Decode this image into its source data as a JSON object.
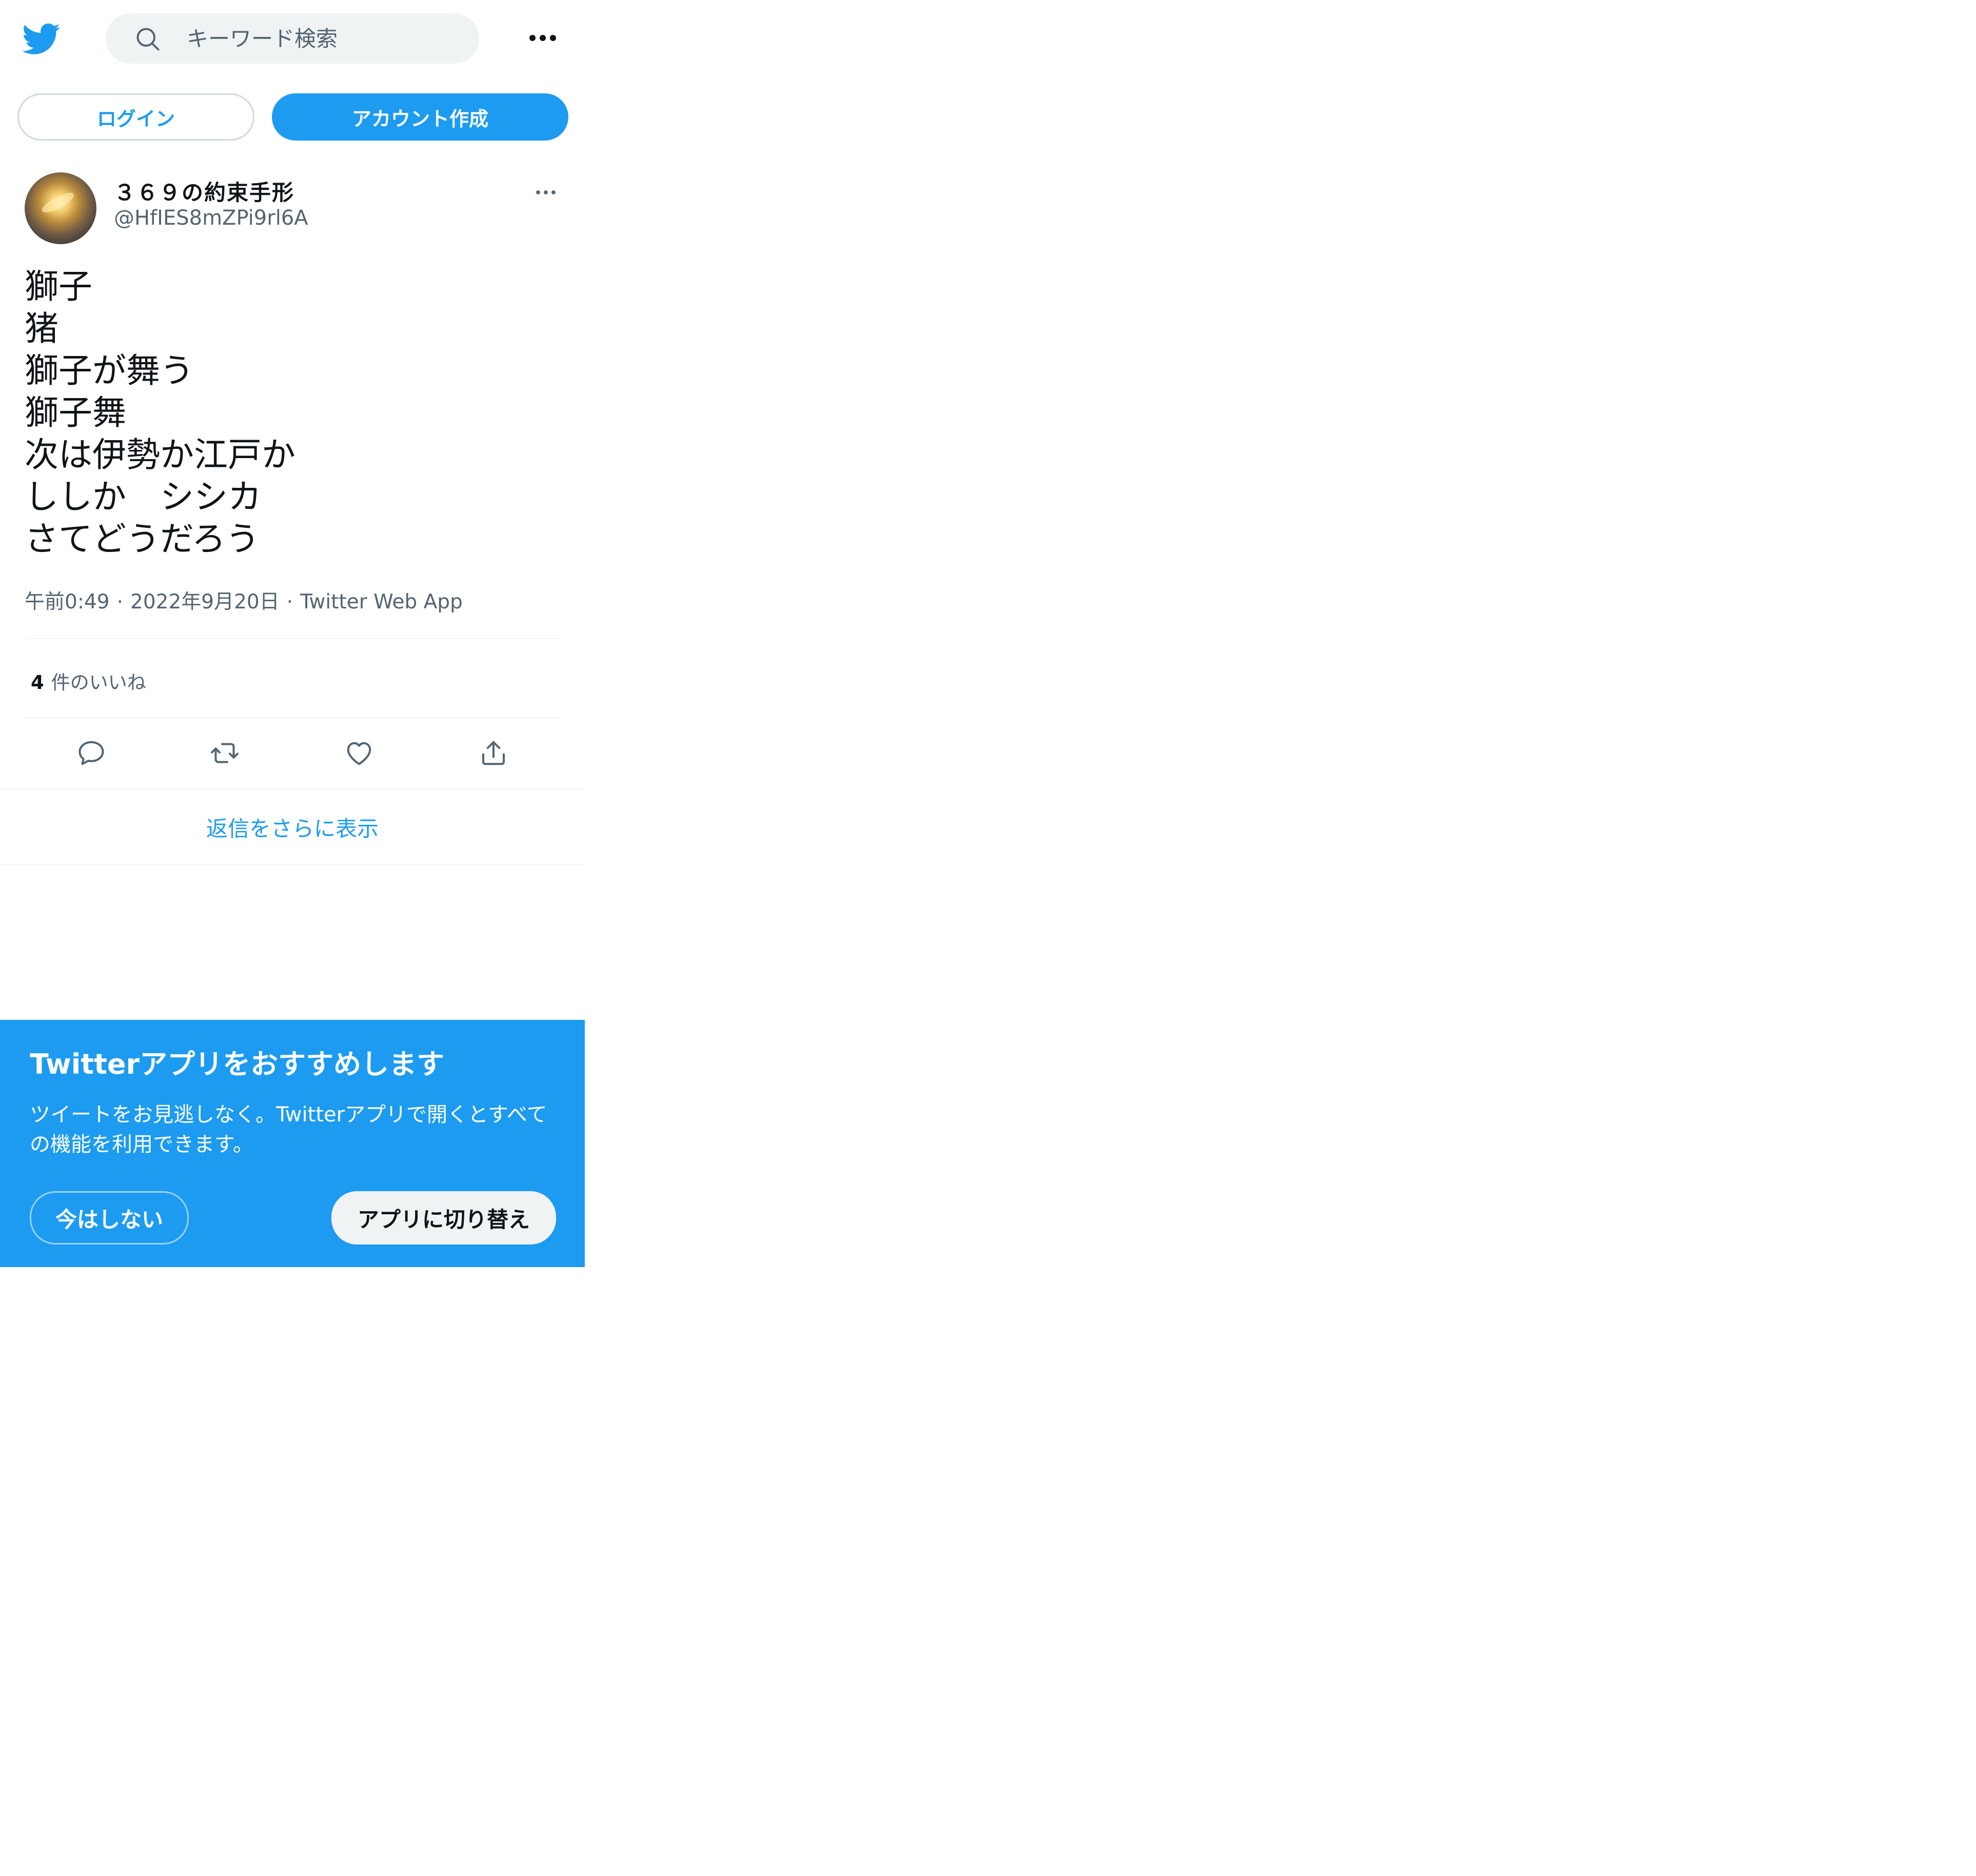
{
  "header": {
    "search_placeholder": "キーワード検索"
  },
  "auth": {
    "login_label": "ログイン",
    "signup_label": "アカウント作成"
  },
  "tweet": {
    "display_name": "３６９の約束手形",
    "username": "@HfIES8mZPi9rl6A",
    "lines": [
      "獅子",
      "猪",
      "獅子が舞う",
      "獅子舞",
      "次は伊勢か江戸か",
      "ししか　シシカ",
      "さてどうだろう"
    ],
    "time": "午前0:49",
    "date": "2022年9月20日",
    "source": "Twitter Web App",
    "separator": "·",
    "likes_count": "4",
    "likes_label": "件のいいね"
  },
  "replies": {
    "show_more_label": "返信をさらに表示"
  },
  "banner": {
    "title": "Twitterアプリをおすすめします",
    "description": "ツイートをお見逃しなく。Twitterアプリで開くとすべての機能を利用できます。",
    "not_now_label": "今はしない",
    "switch_label": "アプリに切り替え"
  },
  "icons": {
    "logo": "twitter-bird-icon",
    "search": "search-icon",
    "more": "more-icon",
    "reply": "reply-icon",
    "retweet": "retweet-icon",
    "like": "heart-icon",
    "share": "share-icon"
  },
  "colors": {
    "accent": "#1d9bf0",
    "text_primary": "#0f1419",
    "text_secondary": "#536471",
    "search_bg": "#eff3f4"
  }
}
